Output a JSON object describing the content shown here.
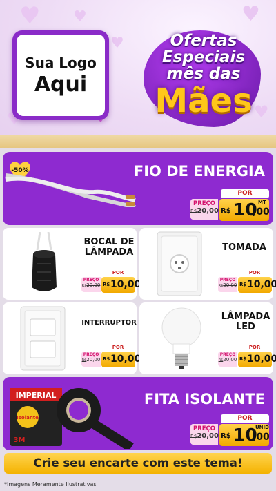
{
  "header": {
    "logo_line1": "Sua Logo",
    "logo_line2": "Aqui",
    "title_line1": "Ofertas",
    "title_line2": "Especiais",
    "title_line3": "mês das",
    "title_line4": "Mães"
  },
  "products": [
    {
      "name": "FIO DE ENERGIA",
      "discount_badge": "-50%",
      "price_label": "PREÇO",
      "old_currency": "R$",
      "old_price": "20,00",
      "por_label": "POR",
      "currency": "R$",
      "new_price_int": "10",
      "new_price_dec": ",00",
      "unit": "MT"
    },
    {
      "name_line1": "BOCAL DE",
      "name_line2": "LÂMPADA",
      "price_label": "PREÇO",
      "old_currency": "R$",
      "old_price": "20,00",
      "por_label": "POR",
      "currency": "R$",
      "new_price": "10,00"
    },
    {
      "name": "TOMADA",
      "price_label": "PREÇO",
      "old_currency": "R$",
      "old_price": "20,00",
      "por_label": "POR",
      "currency": "R$",
      "new_price": "10,00"
    },
    {
      "name": "INTERRUPTOR",
      "price_label": "PREÇO",
      "old_currency": "R$",
      "old_price": "20,00",
      "por_label": "POR",
      "currency": "R$",
      "new_price": "10,00"
    },
    {
      "name_line1": "LÂMPADA",
      "name_line2": "LED",
      "price_label": "PREÇO",
      "old_currency": "R$",
      "old_price": "20,00",
      "por_label": "POR",
      "currency": "R$",
      "new_price": "10,00"
    },
    {
      "name": "FITA ISOLANTE",
      "price_label": "PREÇO",
      "old_currency": "R$",
      "old_price": "20,00",
      "por_label": "POR",
      "currency": "R$",
      "new_price_int": "10",
      "new_price_dec": ",00",
      "unit": "UNID",
      "tape_brand": "IMPERIAL",
      "tape_label": "Isolante",
      "tape_logo": "3M"
    }
  ],
  "footer": {
    "cta": "Crie seu encarte com este tema!",
    "disclaimer": "*Imagens Meramente Ilustrativas"
  },
  "colors": {
    "purple": "#8e2ad0",
    "gold": "#f4b200",
    "pink": "#d4146e"
  }
}
